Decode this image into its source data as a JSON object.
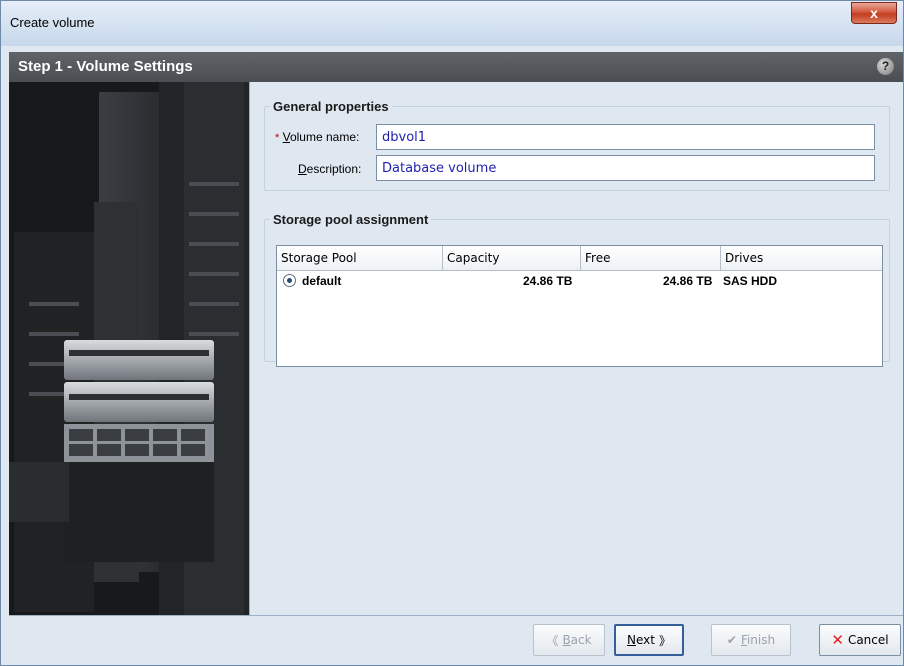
{
  "window": {
    "title": "Create volume",
    "close_glyph": "x"
  },
  "step": {
    "title": "Step 1 - Volume Settings",
    "help_glyph": "?"
  },
  "general": {
    "legend": "General properties",
    "required_marker": "*",
    "volume_name_label_key": "V",
    "volume_name_label_rest": "olume name:",
    "volume_name_value": "dbvol1",
    "description_label_key": "D",
    "description_label_rest": "escription:",
    "description_value": "Database volume"
  },
  "storage": {
    "legend": "Storage pool assignment",
    "columns": [
      "Storage Pool",
      "Capacity",
      "Free",
      "Drives"
    ],
    "rows": [
      {
        "pool": "default",
        "capacity": "24.86 TB",
        "free": "24.86 TB",
        "drives": "SAS HDD",
        "selected": true
      }
    ]
  },
  "buttons": {
    "back_key": "B",
    "back_rest": "ack",
    "next_key": "N",
    "next_rest": "ext",
    "finish_key": "F",
    "finish_rest": "inish",
    "cancel": "Cancel"
  },
  "icons": {
    "back": "double-chevron-left-icon",
    "next": "double-chevron-right-icon",
    "finish": "checkmark-icon",
    "cancel": "red-x-icon",
    "help": "help-icon"
  }
}
